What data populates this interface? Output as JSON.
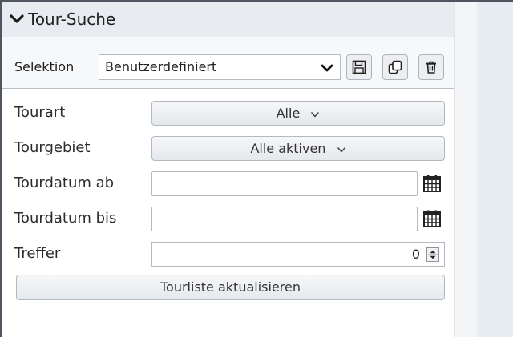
{
  "panel": {
    "title": "Tour-Suche",
    "icon": "chevron-down-icon"
  },
  "selection": {
    "label": "Selektion",
    "value": "Benutzerdefiniert",
    "buttons": [
      "save-icon",
      "copy-icon",
      "trash-icon"
    ]
  },
  "form": {
    "tourart": {
      "label": "Tourart",
      "value": "Alle"
    },
    "tourgebiet": {
      "label": "Tourgebiet",
      "value": "Alle aktiven"
    },
    "date_from": {
      "label": "Tourdatum ab",
      "value": ""
    },
    "date_to": {
      "label": "Tourdatum bis",
      "value": ""
    },
    "treffer": {
      "label": "Treffer",
      "value": "0"
    },
    "refresh_label": "Tourliste aktualisieren"
  },
  "colors": {
    "header_bg": "#e8ecf1",
    "right_panel_bg": "#e8edf4",
    "border": "#b3b9c1"
  }
}
